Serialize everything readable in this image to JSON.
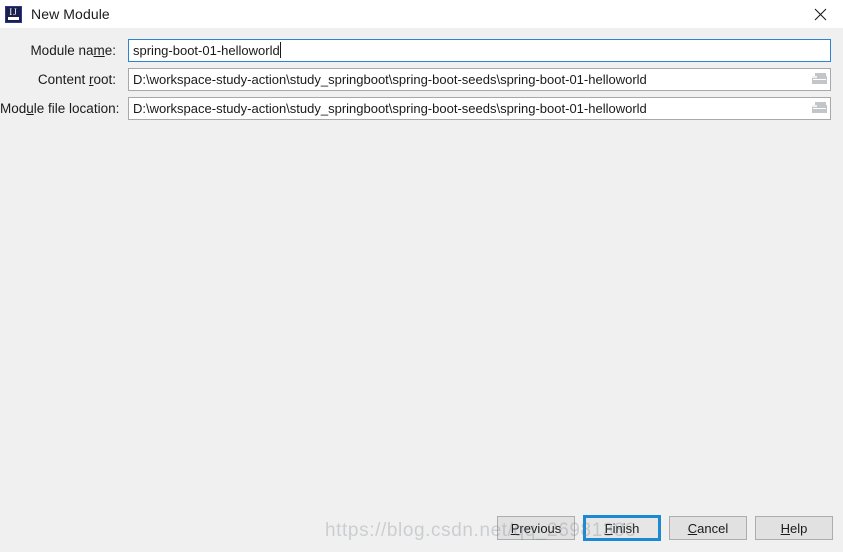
{
  "window": {
    "title": "New Module",
    "app_icon": "intellij-idea-icon",
    "icon_letters": "IJ",
    "close_label": "✕"
  },
  "form": {
    "fields": [
      {
        "label_before": "Module na",
        "label_mnemonic": "m",
        "label_after": "e:",
        "value": "spring-boot-01-helloworld",
        "focused": true,
        "has_browse": false,
        "has_caret": true,
        "name": "module-name"
      },
      {
        "label_before": "Content ",
        "label_mnemonic": "r",
        "label_after": "oot:",
        "value": "D:\\workspace-study-action\\study_springboot\\spring-boot-seeds\\spring-boot-01-helloworld",
        "focused": false,
        "has_browse": true,
        "has_caret": false,
        "name": "content-root"
      },
      {
        "label_before": "Mod",
        "label_mnemonic": "u",
        "label_after": "le file location:",
        "value": "D:\\workspace-study-action\\study_springboot\\spring-boot-seeds\\spring-boot-01-helloworld",
        "focused": false,
        "has_browse": true,
        "has_caret": false,
        "name": "module-file-location"
      }
    ],
    "browse_icon": "folder-icon"
  },
  "buttons": {
    "previous": {
      "before": "",
      "mnemonic": "P",
      "after": "revious"
    },
    "finish": {
      "before": "",
      "mnemonic": "F",
      "after": "inish"
    },
    "cancel": {
      "before": "",
      "mnemonic": "C",
      "after": "ancel"
    },
    "help": {
      "before": "",
      "mnemonic": "H",
      "after": "elp"
    }
  },
  "watermark": {
    "text": "https://blog.csdn.net/qq_26981333"
  },
  "colors": {
    "focus_blue": "#1b8ad1",
    "field_focus_border": "#2f83d6",
    "window_bg": "#f0f0f0",
    "titlebar_bg": "#ffffff",
    "button_bg": "#e1e1e1",
    "icon_navy": "#1b1f4b"
  }
}
